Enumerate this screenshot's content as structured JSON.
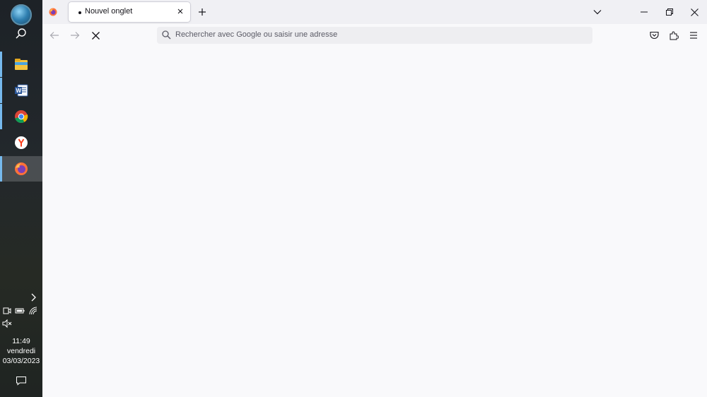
{
  "taskbar": {
    "apps": [
      {
        "name": "file-explorer",
        "active": false
      },
      {
        "name": "word",
        "active": false
      },
      {
        "name": "chrome",
        "active": false
      },
      {
        "name": "yandex",
        "active": false
      },
      {
        "name": "firefox",
        "active": true
      }
    ],
    "clock": {
      "time": "11:49",
      "day": "vendredi",
      "date": "03/03/2023"
    }
  },
  "browser": {
    "tab": {
      "title": "Nouvel onglet"
    },
    "urlbar": {
      "placeholder": "Rechercher avec Google ou saisir une adresse"
    }
  }
}
